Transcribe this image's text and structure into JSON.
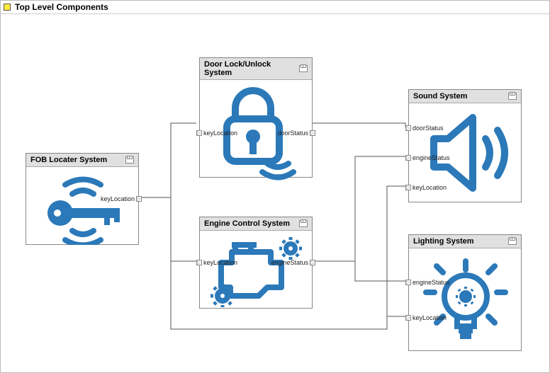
{
  "panel_title": "Top Level Components",
  "accent_color": "#2b79b9",
  "components": {
    "fob": {
      "title": "FOB Locater System",
      "ports": {
        "out_keyLocation": "keyLocation"
      }
    },
    "door": {
      "title": "Door Lock/Unlock System",
      "ports": {
        "in_keyLocation": "keyLocation",
        "out_doorStatus": "doorStatus"
      }
    },
    "engine": {
      "title": "Engine Control System",
      "ports": {
        "in_keyLocation": "keyLocation",
        "out_engineStatus": "engineStatus"
      }
    },
    "sound": {
      "title": "Sound System",
      "ports": {
        "in_doorStatus": "doorStatus",
        "in_engineStatus": "engineStatus",
        "in_keyLocation": "keyLocation"
      }
    },
    "light": {
      "title": "Lighting System",
      "ports": {
        "in_engineStatus": "engineStatus",
        "in_keyLocation": "keyLocation"
      }
    }
  },
  "connections": [
    {
      "from": "fob.out_keyLocation",
      "to": "door.in_keyLocation"
    },
    {
      "from": "fob.out_keyLocation",
      "to": "engine.in_keyLocation"
    },
    {
      "from": "fob.out_keyLocation",
      "to": "sound.in_keyLocation"
    },
    {
      "from": "fob.out_keyLocation",
      "to": "light.in_keyLocation"
    },
    {
      "from": "door.out_doorStatus",
      "to": "sound.in_doorStatus"
    },
    {
      "from": "engine.out_engineStatus",
      "to": "sound.in_engineStatus"
    },
    {
      "from": "engine.out_engineStatus",
      "to": "light.in_engineStatus"
    }
  ]
}
